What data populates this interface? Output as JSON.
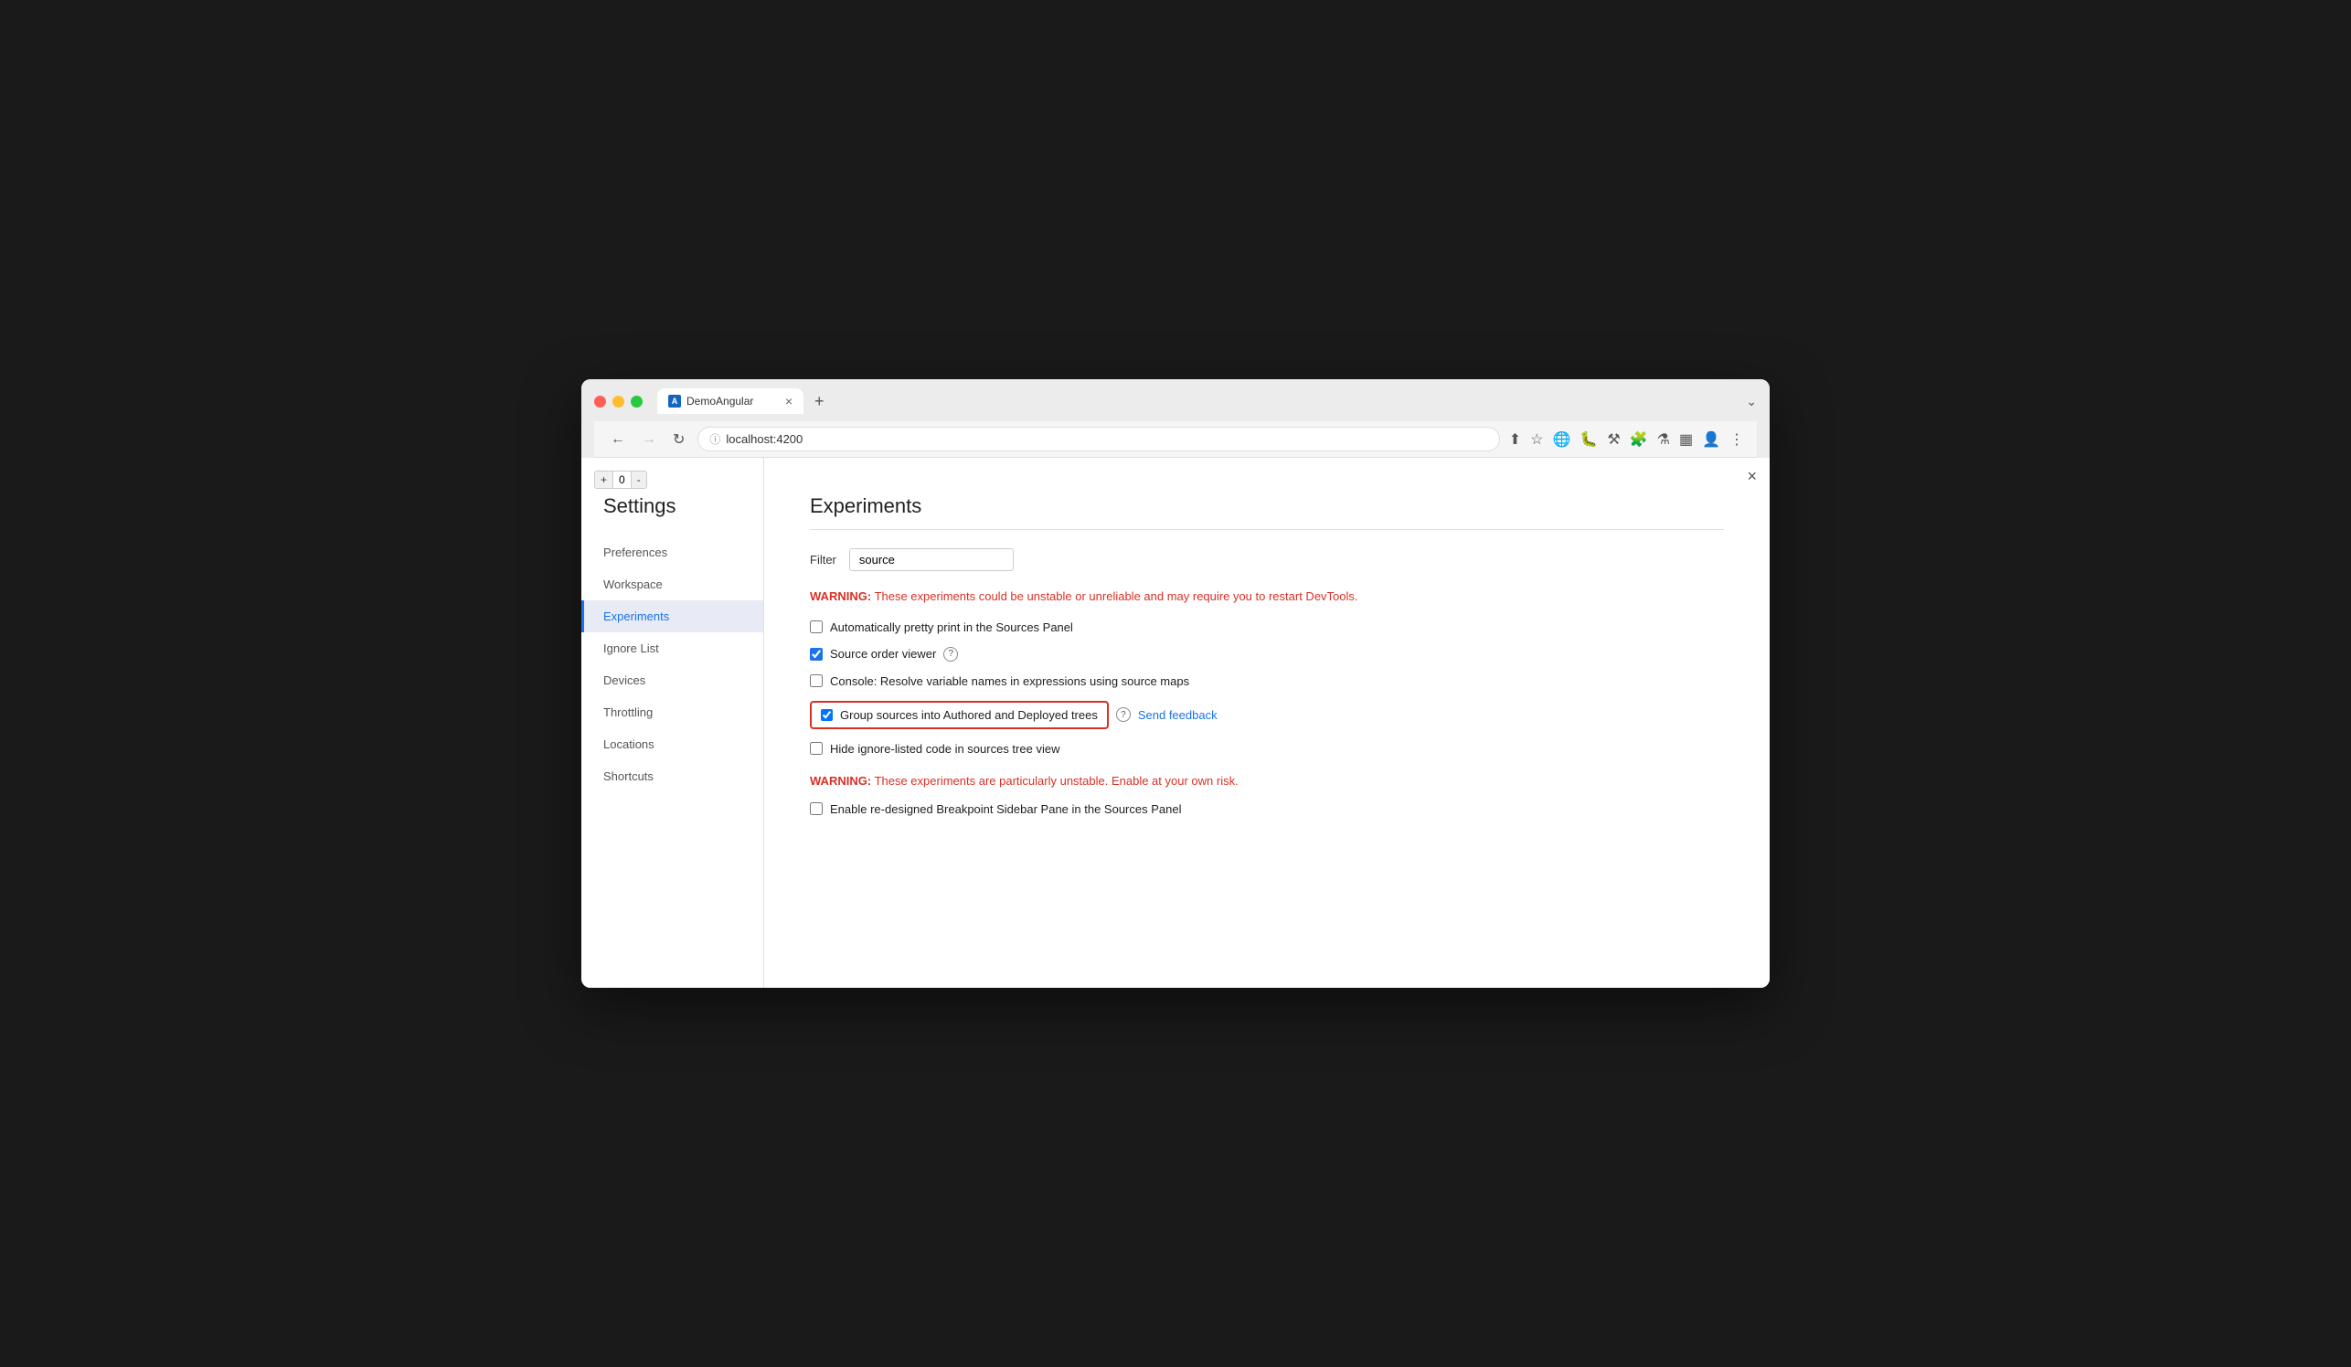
{
  "browser": {
    "tab_title": "DemoAngular",
    "tab_favicon": "A",
    "address": "localhost:4200",
    "close_icon": "×",
    "new_tab_icon": "+",
    "chevron_icon": "⌄"
  },
  "code_counter": {
    "plus": "+",
    "value": "0",
    "minus": "-"
  },
  "panel_close": "×",
  "settings": {
    "title": "Settings",
    "sidebar_items": [
      {
        "id": "preferences",
        "label": "Preferences",
        "active": false
      },
      {
        "id": "workspace",
        "label": "Workspace",
        "active": false
      },
      {
        "id": "experiments",
        "label": "Experiments",
        "active": true
      },
      {
        "id": "ignore-list",
        "label": "Ignore List",
        "active": false
      },
      {
        "id": "devices",
        "label": "Devices",
        "active": false
      },
      {
        "id": "throttling",
        "label": "Throttling",
        "active": false
      },
      {
        "id": "locations",
        "label": "Locations",
        "active": false
      },
      {
        "id": "shortcuts",
        "label": "Shortcuts",
        "active": false
      }
    ]
  },
  "experiments": {
    "title": "Experiments",
    "filter_label": "Filter",
    "filter_value": "source",
    "filter_placeholder": "Filter",
    "warning1": {
      "prefix": "WARNING:",
      "text": " These experiments could be unstable or unreliable and may require you to restart DevTools."
    },
    "items": [
      {
        "id": "pretty-print",
        "label": "Automatically pretty print in the Sources Panel",
        "checked": false,
        "has_help": false,
        "highlighted": false
      },
      {
        "id": "source-order-viewer",
        "label": "Source order viewer",
        "checked": true,
        "has_help": true,
        "highlighted": false
      },
      {
        "id": "console-source-maps",
        "label": "Console: Resolve variable names in expressions using source maps",
        "checked": false,
        "has_help": false,
        "highlighted": false
      },
      {
        "id": "group-sources",
        "label": "Group sources into Authored and Deployed trees",
        "checked": true,
        "has_help": true,
        "highlighted": true,
        "send_feedback_label": "Send feedback"
      },
      {
        "id": "hide-ignore-listed",
        "label": "Hide ignore-listed code in sources tree view",
        "checked": false,
        "has_help": false,
        "highlighted": false
      }
    ],
    "warning2": {
      "prefix": "WARNING:",
      "text": " These experiments are particularly unstable. Enable at your own risk."
    },
    "unstable_items": [
      {
        "id": "redesigned-breakpoint",
        "label": "Enable re-designed Breakpoint Sidebar Pane in the Sources Panel",
        "checked": false
      }
    ],
    "help_icon": "?",
    "feedback_icon": "?"
  }
}
